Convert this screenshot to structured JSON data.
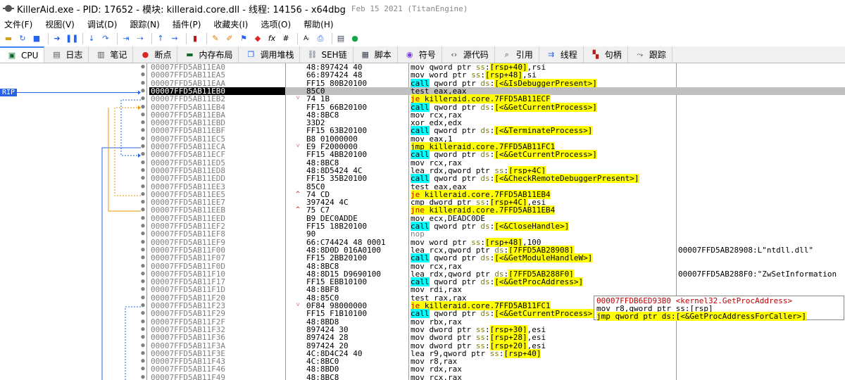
{
  "window": {
    "title": "KillerAid.exe - PID: 17652 - 模块: killeraid.core.dll - 线程: 14156 - x64dbg",
    "meta": "Feb 15 2021 (TitanEngine)"
  },
  "menu": [
    "文件(F)",
    "视图(V)",
    "调试(D)",
    "跟踪(N)",
    "插件(P)",
    "收藏夹(I)",
    "选项(O)",
    "帮助(H)"
  ],
  "toolbar_icons": [
    "open-icon",
    "restart-icon",
    "close-icon",
    "run-icon",
    "pause-icon",
    "step-into-icon",
    "step-over-icon",
    "run-to-user-icon",
    "run-to-cursor-icon",
    "execute-till-return-icon",
    "run-until-expression-icon",
    "scylla-icon",
    "patch-icon",
    "comment-icon",
    "bookmark-icon",
    "breakpoint-icon",
    "function-icon",
    "hash-icon",
    "font-icon",
    "strings-icon",
    "calc-icon",
    "globe-icon"
  ],
  "tabs": [
    {
      "label": "CPU",
      "icon": "cpu-icon",
      "active": true
    },
    {
      "label": "日志",
      "icon": "log-icon",
      "active": false
    },
    {
      "label": "笔记",
      "icon": "notes-icon",
      "active": false
    },
    {
      "label": "断点",
      "icon": "breakpoint-dot-icon",
      "active": false
    },
    {
      "label": "内存布局",
      "icon": "memory-map-icon",
      "active": false
    },
    {
      "label": "调用堆栈",
      "icon": "call-stack-icon",
      "active": false
    },
    {
      "label": "SEH链",
      "icon": "seh-icon",
      "active": false
    },
    {
      "label": "脚本",
      "icon": "script-icon",
      "active": false
    },
    {
      "label": "符号",
      "icon": "symbols-icon",
      "active": false
    },
    {
      "label": "源代码",
      "icon": "source-icon",
      "active": false
    },
    {
      "label": "引用",
      "icon": "references-icon",
      "active": false
    },
    {
      "label": "线程",
      "icon": "threads-icon",
      "active": false
    },
    {
      "label": "句柄",
      "icon": "handles-icon",
      "active": false
    },
    {
      "label": "跟踪",
      "icon": "trace-icon",
      "active": false
    }
  ],
  "rip_label": "RIP",
  "rows": [
    {
      "addr": "00007FFD5AB11EA0",
      "bytes": "48:897424 40",
      "instr": "mov qword ptr ss:[rsp+40],rsi",
      "kind": "normal",
      "comment": ""
    },
    {
      "addr": "00007FFD5AB11EA5",
      "bytes": "66:897424 48",
      "instr": "mov word ptr ss:[rsp+48],si",
      "kind": "normal",
      "comment": ""
    },
    {
      "addr": "00007FFD5AB11EAA",
      "bytes": "FF15 80B20100",
      "instr": "call qword ptr ds:[<&IsDebuggerPresent>]",
      "kind": "call",
      "comment": ""
    },
    {
      "addr": "00007FFD5AB11EB0",
      "bytes": "85C0",
      "instr": "test eax,eax",
      "kind": "normal",
      "comment": "",
      "current": true
    },
    {
      "addr": "00007FFD5AB11EB2",
      "bytes": "74 1B",
      "instr": "je killeraid.core.7FFD5AB11ECF",
      "kind": "jcc",
      "comment": "",
      "arrow": "down"
    },
    {
      "addr": "00007FFD5AB11EB4",
      "bytes": "FF15 66B20100",
      "instr": "call qword ptr ds:[<&GetCurrentProcess>]",
      "kind": "call",
      "comment": ""
    },
    {
      "addr": "00007FFD5AB11EBA",
      "bytes": "48:8BC8",
      "instr": "mov rcx,rax",
      "kind": "normal",
      "comment": ""
    },
    {
      "addr": "00007FFD5AB11EBD",
      "bytes": "33D2",
      "instr": "xor edx,edx",
      "kind": "normal",
      "comment": ""
    },
    {
      "addr": "00007FFD5AB11EBF",
      "bytes": "FF15 63B20100",
      "instr": "call qword ptr ds:[<&TerminateProcess>]",
      "kind": "call",
      "comment": ""
    },
    {
      "addr": "00007FFD5AB11EC5",
      "bytes": "B8 01000000",
      "instr": "mov eax,1",
      "kind": "normal",
      "comment": ""
    },
    {
      "addr": "00007FFD5AB11ECA",
      "bytes": "E9 F2000000",
      "instr": "jmp killeraid.core.7FFD5AB11FC1",
      "kind": "jmp",
      "comment": "",
      "arrow": "down"
    },
    {
      "addr": "00007FFD5AB11ECF",
      "bytes": "FF15 4BB20100",
      "instr": "call qword ptr ds:[<&GetCurrentProcess>]",
      "kind": "call",
      "comment": ""
    },
    {
      "addr": "00007FFD5AB11ED5",
      "bytes": "48:8BC8",
      "instr": "mov rcx,rax",
      "kind": "normal",
      "comment": ""
    },
    {
      "addr": "00007FFD5AB11ED8",
      "bytes": "48:8D5424 4C",
      "instr": "lea rdx,qword ptr ss:[rsp+4C]",
      "kind": "normal",
      "comment": ""
    },
    {
      "addr": "00007FFD5AB11EDD",
      "bytes": "FF15 35B20100",
      "instr": "call qword ptr ds:[<&CheckRemoteDebuggerPresent>]",
      "kind": "call",
      "comment": ""
    },
    {
      "addr": "00007FFD5AB11EE3",
      "bytes": "85C0",
      "instr": "test eax,eax",
      "kind": "normal",
      "comment": ""
    },
    {
      "addr": "00007FFD5AB11EE5",
      "bytes": "74 CD",
      "instr": "je killeraid.core.7FFD5AB11EB4",
      "kind": "jcc",
      "comment": "",
      "arrow": "up"
    },
    {
      "addr": "00007FFD5AB11EE7",
      "bytes": "397424 4C",
      "instr": "cmp dword ptr ss:[rsp+4C],esi",
      "kind": "normal",
      "comment": ""
    },
    {
      "addr": "00007FFD5AB11EEB",
      "bytes": "75 C7",
      "instr": "jne killeraid.core.7FFD5AB11EB4",
      "kind": "jcc",
      "comment": "",
      "arrow": "up"
    },
    {
      "addr": "00007FFD5AB11EED",
      "bytes": "B9 DEC0ADDE",
      "instr": "mov ecx,DEADC0DE",
      "kind": "normal",
      "comment": ""
    },
    {
      "addr": "00007FFD5AB11EF2",
      "bytes": "FF15 18B20100",
      "instr": "call qword ptr ds:[<&CloseHandle>]",
      "kind": "call",
      "comment": ""
    },
    {
      "addr": "00007FFD5AB11EF8",
      "bytes": "90",
      "instr": "nop",
      "kind": "nop",
      "comment": ""
    },
    {
      "addr": "00007FFD5AB11EF9",
      "bytes": "66:C74424 48 0001",
      "instr": "mov word ptr ss:[rsp+48],100",
      "kind": "normal",
      "comment": ""
    },
    {
      "addr": "00007FFD5AB11F00",
      "bytes": "48:8D0D 016A0100",
      "instr": "lea rcx,qword ptr ds:[7FFD5AB28908]",
      "kind": "normal",
      "comment": "00007FFD5AB28908:L\"ntdll.dll\""
    },
    {
      "addr": "00007FFD5AB11F07",
      "bytes": "FF15 2BB20100",
      "instr": "call qword ptr ds:[<&GetModuleHandleW>]",
      "kind": "call",
      "comment": ""
    },
    {
      "addr": "00007FFD5AB11F0D",
      "bytes": "48:8BC8",
      "instr": "mov rcx,rax",
      "kind": "normal",
      "comment": ""
    },
    {
      "addr": "00007FFD5AB11F10",
      "bytes": "48:8D15 D9690100",
      "instr": "lea rdx,qword ptr ds:[7FFD5AB288F0]",
      "kind": "normal",
      "comment": "00007FFD5AB288F0:\"ZwSetInformation"
    },
    {
      "addr": "00007FFD5AB11F17",
      "bytes": "FF15 EBB10100",
      "instr": "call qword ptr ds:[<&GetProcAddress>]",
      "kind": "call",
      "comment": ""
    },
    {
      "addr": "00007FFD5AB11F1D",
      "bytes": "48:8BF8",
      "instr": "mov rdi,rax",
      "kind": "normal",
      "comment": ""
    },
    {
      "addr": "00007FFD5AB11F20",
      "bytes": "48:85C0",
      "instr": "test rax,rax",
      "kind": "normal",
      "comment": ""
    },
    {
      "addr": "00007FFD5AB11F23",
      "bytes": "0F84 98000000",
      "instr": "je killeraid.core.7FFD5AB11FC1",
      "kind": "jcc",
      "comment": "",
      "arrow": "down"
    },
    {
      "addr": "00007FFD5AB11F29",
      "bytes": "FF15 F1B10100",
      "instr": "call qword ptr ds:[<&GetCurrentProcess>]",
      "kind": "call",
      "comment": ""
    },
    {
      "addr": "00007FFD5AB11F2F",
      "bytes": "48:8BD8",
      "instr": "mov rbx,rax",
      "kind": "normal",
      "comment": ""
    },
    {
      "addr": "00007FFD5AB11F32",
      "bytes": "897424 30",
      "instr": "mov dword ptr ss:[rsp+30],esi",
      "kind": "normal",
      "comment": ""
    },
    {
      "addr": "00007FFD5AB11F36",
      "bytes": "897424 28",
      "instr": "mov dword ptr ss:[rsp+28],esi",
      "kind": "normal",
      "comment": ""
    },
    {
      "addr": "00007FFD5AB11F3A",
      "bytes": "897424 20",
      "instr": "mov dword ptr ss:[rsp+20],esi",
      "kind": "normal",
      "comment": ""
    },
    {
      "addr": "00007FFD5AB11F3E",
      "bytes": "4C:8D4C24 40",
      "instr": "lea r9,qword ptr ss:[rsp+40]",
      "kind": "normal",
      "comment": ""
    },
    {
      "addr": "00007FFD5AB11F43",
      "bytes": "4C:8BC0",
      "instr": "mov r8,rax",
      "kind": "normal",
      "comment": ""
    },
    {
      "addr": "00007FFD5AB11F46",
      "bytes": "48:8BD0",
      "instr": "mov rdx,rax",
      "kind": "normal",
      "comment": ""
    },
    {
      "addr": "00007FFD5AB11F49",
      "bytes": "48:8BC8",
      "instr": "mov rcx,rax",
      "kind": "normal",
      "comment": ""
    }
  ],
  "tooltip": {
    "line1_addr": "00007FFDB6ED93B0",
    "line1_sym": "<kernel32.GetProcAddress>",
    "line2": "mov r8,qword ptr ss:[rsp]",
    "line3": "jmp qword ptr ds:[<&GetProcAddressForCaller>]"
  },
  "colors": {
    "call_bg": "#00ffff",
    "jump_bg": "#ffff00",
    "jcc_text": "#c00000",
    "current_addr_bg": "#000000",
    "current_row_bg": "#c0c0c0",
    "rip_bg": "#2563eb"
  }
}
